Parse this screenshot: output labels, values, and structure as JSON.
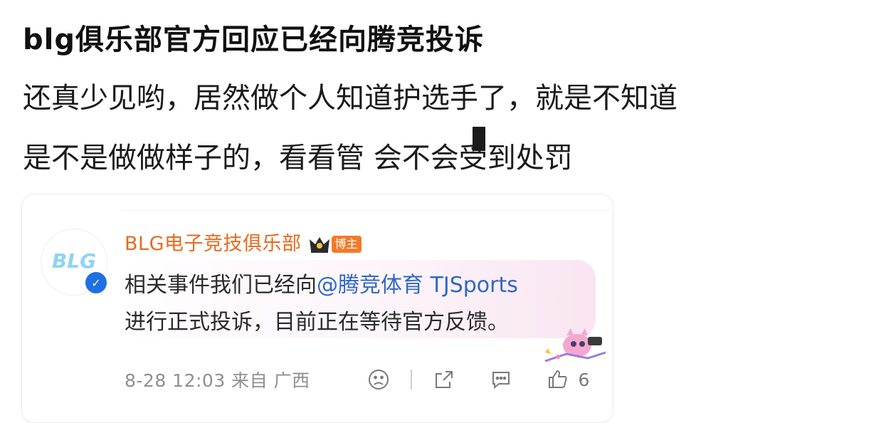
{
  "post": {
    "title": "blg俱乐部官方回应已经向腾竞投诉",
    "body_line1": "还真少见哟，居然做个人知道护选手了，就是不知道",
    "body_line2": "是不是做做样子的，看看管 会不会受到处罚"
  },
  "card": {
    "username": "BLG电子竞技俱乐部",
    "badge": "博主",
    "avatar_text": "BLG",
    "quote_prefix": "相关事件我们已经向",
    "mention": "@腾竞体育 TJSports",
    "quote_line2": "进行正式投诉，目前正在等待官方反馈。",
    "meta": "8-28 12:03 来自 广西",
    "like_count": "6"
  },
  "icons": [
    "crown-icon",
    "verified-icon",
    "dislike-face-icon",
    "share-icon",
    "comment-icon",
    "thumbs-up-icon"
  ],
  "colors": {
    "username": "#e8691e",
    "mention": "#2f68c6",
    "badge": "#f27b29",
    "verified": "#1f6fe5"
  }
}
